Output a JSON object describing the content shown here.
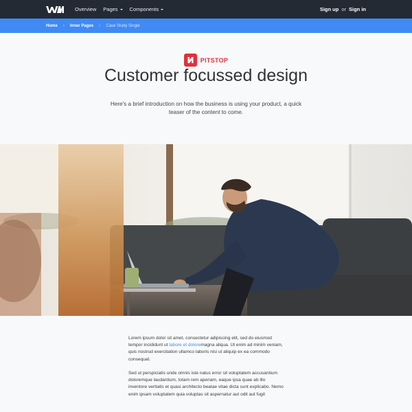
{
  "nav": {
    "links": [
      {
        "label": "Overview",
        "has_caret": false
      },
      {
        "label": "Pages",
        "has_caret": true
      },
      {
        "label": "Components",
        "has_caret": true
      }
    ],
    "signup": "Sign up",
    "or": "or",
    "signin": "Sign in"
  },
  "breadcrumb": {
    "items": [
      "Home",
      "Inner Pages",
      "Case Study Single"
    ],
    "separator": "›"
  },
  "hero": {
    "brand_name": "PITSTOP",
    "title": "Customer focussed design",
    "intro": "Here's a brief introduction on how the business is using your product, a quick teaser of the content to come."
  },
  "content": {
    "p1_before": "Lorem ipsum dolor sit amet, consectetur adipiscing elit, sed do eiusmod tempor incididunt ut ",
    "p1_link": "labore et dolore",
    "p1_after": "magna aliqua. Ut enim ad minim veniam, quis nostrud exercitation ullamco laboris nisi ut aliquip ex ea commodo consequat.",
    "p2": "Sed ut perspiciatis unde omnis iste natus error sit voluptatem accusantium doloremque laudantium, totam rem aperiam, eaque ipsa quae ab illo inventore veritatis et quasi architecto beatae vitae dicta sunt explicabo. Nemo enim ipsam voluptatem quia voluptas sit aspernatur aut odit aut fugit"
  },
  "colors": {
    "nav_bg": "#232a33",
    "breadcrumb_bg": "#3f8af4",
    "brand_red": "#e0313c",
    "link_blue": "#3f8af4",
    "page_bg": "#f8f9fb"
  },
  "icons": {
    "logo": "wm-logo-icon",
    "brand": "pitstop-logo-icon"
  }
}
